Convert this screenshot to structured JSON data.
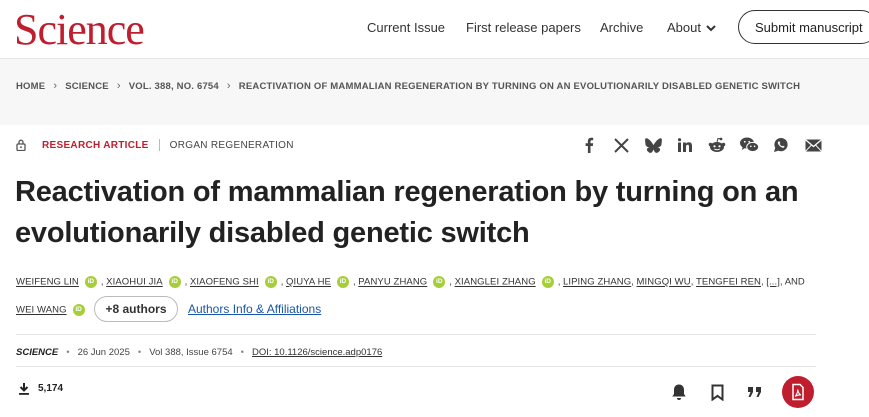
{
  "header": {
    "logo": "Science",
    "nav": [
      "Current Issue",
      "First release papers",
      "Archive",
      "About"
    ],
    "submit": "Submit manuscript"
  },
  "breadcrumb": [
    "HOME",
    "SCIENCE",
    "VOL. 388, NO. 6754",
    "REACTIVATION OF MAMMALIAN REGENERATION BY TURNING ON AN EVOLUTIONARILY DISABLED GENETIC SWITCH"
  ],
  "article": {
    "type": "RESEARCH ARTICLE",
    "topic": "ORGAN REGENERATION",
    "title": "Reactivation of mammalian regeneration by turning on an evolutionarily disabled genetic switch",
    "authors_line1": [
      "WEIFENG LIN",
      "XIAOHUI JIA",
      "XIAOFENG SHI",
      "QIUYA HE",
      "PANYU ZHANG",
      "XIANGLEI ZHANG"
    ],
    "authors_line1_tail": [
      "LIPING ZHANG",
      "MINGQI WU",
      "TENGFEI REN"
    ],
    "ellipsis": "[...]",
    "and": ", AND",
    "last_author": "WEI WANG",
    "orcid_label": "iD",
    "more_authors": "+8 authors",
    "affiliations": "Authors Info & Affiliations",
    "journal": "SCIENCE",
    "date": "26 Jun 2025",
    "volume": "Vol 388, Issue 6754",
    "doi": "DOI: 10.1126/science.adp0176",
    "downloads": "5,174"
  },
  "share_icons": [
    "facebook-icon",
    "x-icon",
    "bluesky-icon",
    "linkedin-icon",
    "reddit-icon",
    "wechat-icon",
    "whatsapp-icon",
    "email-icon"
  ],
  "colors": {
    "brand": "#bf1e2e",
    "orcid": "#a6ce39",
    "link": "#1a56a8"
  }
}
